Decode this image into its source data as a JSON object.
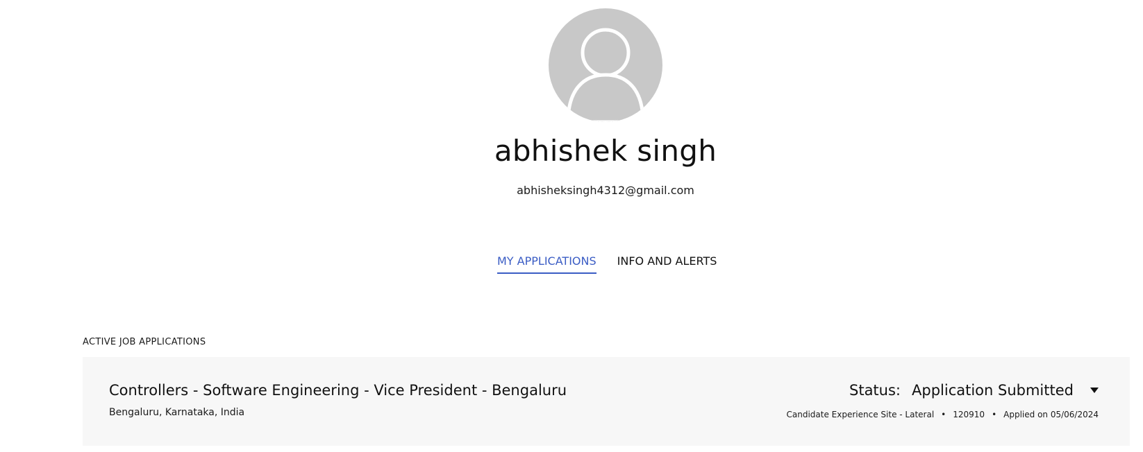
{
  "profile": {
    "name": "abhishek singh",
    "email": "abhisheksingh4312@gmail.com",
    "avatar_icon": "user-silhouette-icon"
  },
  "tabs": [
    {
      "label": "MY APPLICATIONS",
      "active": true
    },
    {
      "label": "INFO AND ALERTS",
      "active": false
    }
  ],
  "applications": {
    "heading": "ACTIVE JOB APPLICATIONS",
    "items": [
      {
        "title": "Controllers - Software Engineering - Vice President - Bengaluru",
        "location": "Bengaluru, Karnataka, India",
        "status_label": "Status:",
        "status_value": "Application Submitted",
        "site": "Candidate Experience Site - Lateral",
        "job_id": "120910",
        "applied": "Applied on 05/06/2024",
        "separator": "•"
      }
    ]
  },
  "colors": {
    "accent": "#3a5cc4",
    "card_background": "#f7f7f7",
    "avatar_fill": "#c8c8c8"
  }
}
